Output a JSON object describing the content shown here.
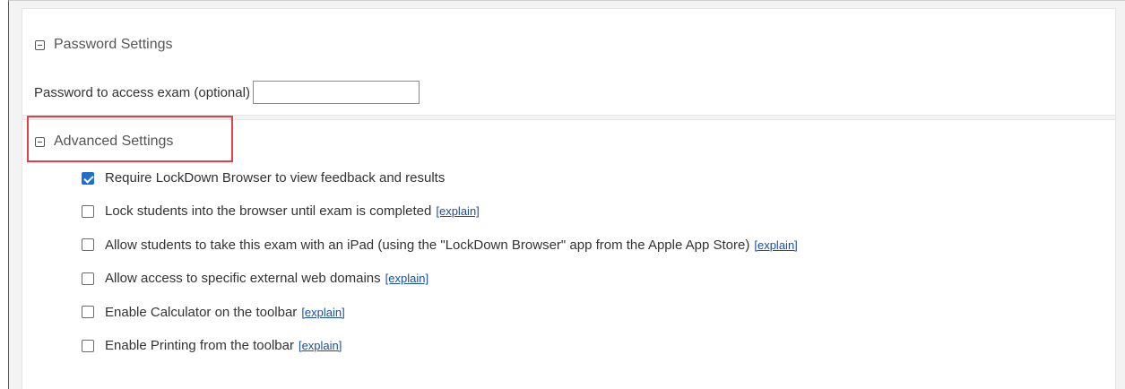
{
  "password_section": {
    "title": "Password Settings",
    "field_label": "Password to access exam (optional)",
    "field_value": ""
  },
  "advanced_section": {
    "title": "Advanced Settings",
    "options": [
      {
        "label": "Require LockDown Browser to view feedback and results",
        "checked": true,
        "explain": ""
      },
      {
        "label": "Lock students into the browser until exam is completed",
        "checked": false,
        "explain": "[explain]"
      },
      {
        "label": "Allow students to take this exam with an iPad (using the \"LockDown Browser\" app from the Apple App Store)",
        "checked": false,
        "explain": "[explain]"
      },
      {
        "label": "Allow access to specific external web domains",
        "checked": false,
        "explain": "[explain]"
      },
      {
        "label": "Enable Calculator on the toolbar",
        "checked": false,
        "explain": "[explain]"
      },
      {
        "label": "Enable Printing from the toolbar",
        "checked": false,
        "explain": "[explain]"
      }
    ]
  },
  "colors": {
    "highlight": "#e0404a",
    "checkbox_checked": "#1f6fcf",
    "link": "#1a4fa0"
  },
  "icons": {
    "section_toggle": "collapse-icon"
  }
}
